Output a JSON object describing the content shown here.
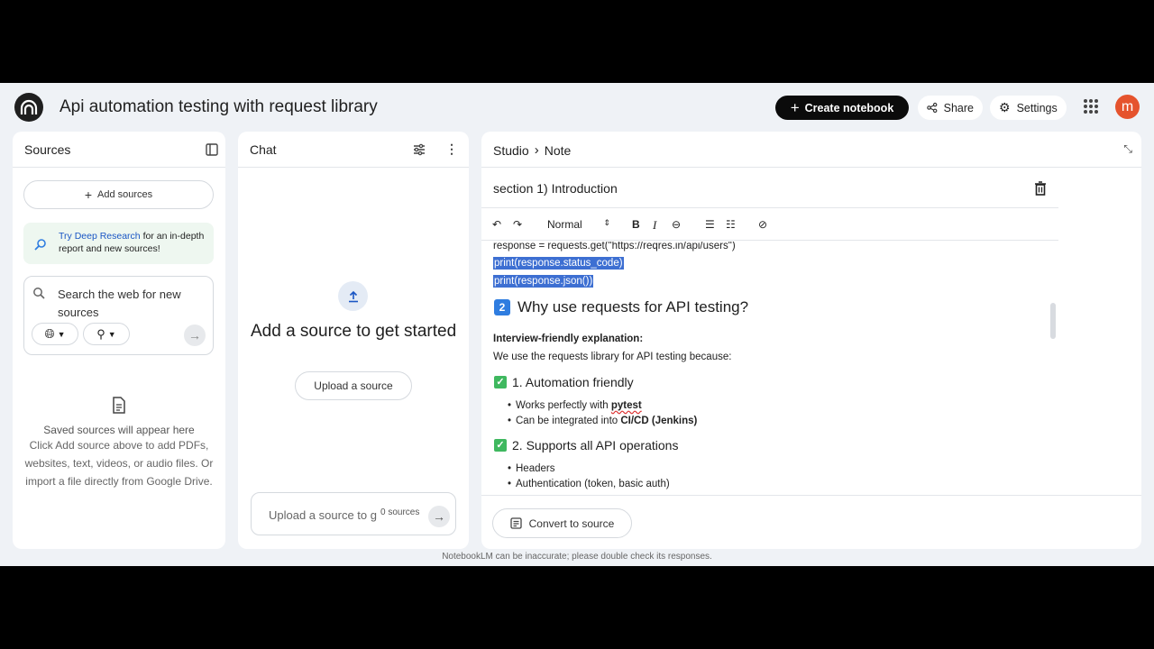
{
  "app": {
    "title": "Api automation testing with request library",
    "create_label": "Create notebook",
    "share_label": "Share",
    "settings_label": "Settings",
    "avatar_letter": "m",
    "disclaimer": "NotebookLM can be inaccurate; please double check its responses."
  },
  "sources": {
    "title": "Sources",
    "add_label": "Add sources",
    "deep_link": "Try Deep Research",
    "deep_rest": " for an in-depth report and new sources!",
    "search_placeholder": "Search the web for new sources",
    "empty_title": "Saved sources will appear here",
    "empty_desc": "Click Add source above to add PDFs, websites, text, videos, or audio files. Or import a file directly from Google Drive."
  },
  "chat": {
    "title": "Chat",
    "heading": "Add a source to get started",
    "upload_label": "Upload a source",
    "input_placeholder": "Upload a source to g",
    "source_count": "0 sources"
  },
  "studio": {
    "crumb_studio": "Studio",
    "crumb_note": "Note",
    "note_title": "section 1) Introduction",
    "format_select": "Normal",
    "code_line1": "response = requests.get(\"https://reqres.in/api/users\")",
    "code_line2": "print(response.status_code)",
    "code_line3": "print(response.json())",
    "h2_num": "2",
    "h2_text": "Why use requests for API testing?",
    "interview_label": "Interview-friendly explanation:",
    "intro_text": "We use the requests library for API testing because:",
    "sec1_title": "1. Automation friendly",
    "sec1_b1_pre": "Works perfectly with ",
    "sec1_b1_bold": "pytest",
    "sec1_b2_pre": "Can be integrated into ",
    "sec1_b2_bold": "CI/CD (Jenkins)",
    "sec2_title": "2. Supports all API operations",
    "sec2_b1": "Headers",
    "sec2_b2": "Authentication (token, basic auth)",
    "convert_label": "Convert to source"
  }
}
